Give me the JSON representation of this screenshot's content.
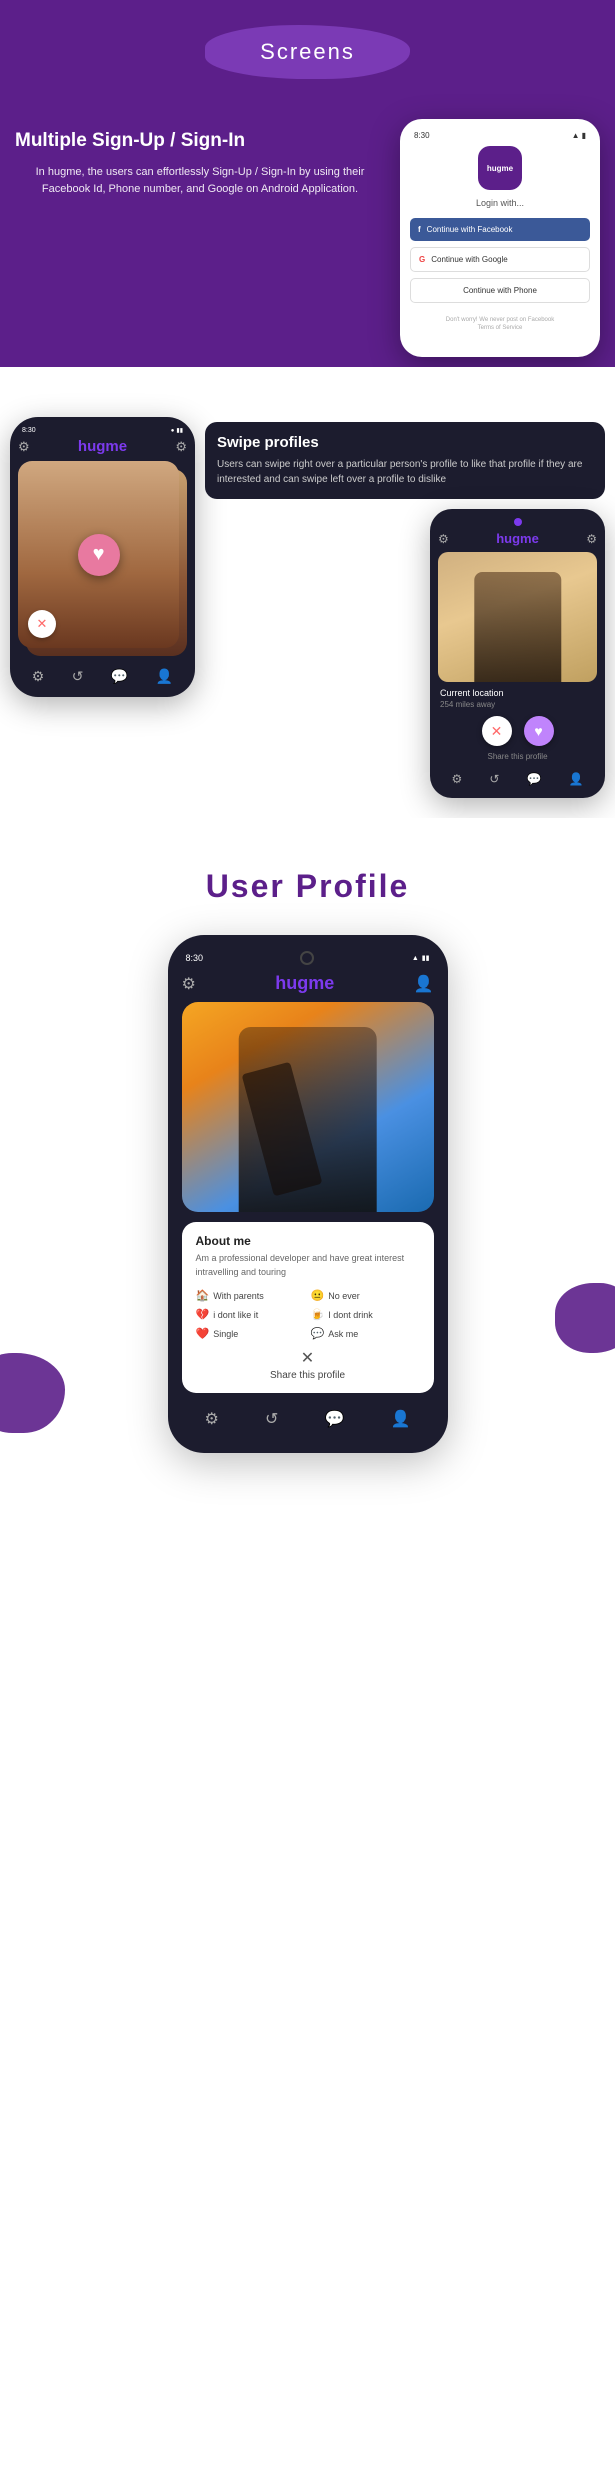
{
  "header": {
    "screens_label": "Screens"
  },
  "signup_section": {
    "title": "Multiple Sign-Up / Sign-In",
    "description": "In hugme, the users can effortlessly Sign-Up / Sign-In by using their Facebook Id, Phone number, and Google on Android Application.",
    "phone": {
      "status_time": "8:30",
      "app_logo": "hugme",
      "login_with": "Login with...",
      "facebook_btn": "Continue with Facebook",
      "google_btn": "Continue with Google",
      "phone_btn": "Continue with Phone",
      "footnote": "Don't worry! We never post on Facebook",
      "terms": "Terms of Service"
    }
  },
  "swipe_section": {
    "title": "Swipe profiles",
    "description": "Users can swipe right over a particular person's profile to like that profile if they are interested and can swipe left over a profile to dislike",
    "phone_left": {
      "status_time": "8:30",
      "logo": "hugme"
    },
    "phone_right": {
      "logo": "hugme",
      "location_label": "Current location",
      "distance": "254 miles away",
      "share_label": "Share this profile"
    }
  },
  "user_profile_section": {
    "title": "User Profile",
    "phone": {
      "status_time": "8:30",
      "logo": "hugme",
      "about_title": "About me",
      "about_text": "Am a professional developer and have great interest intravelling and touring",
      "tags": [
        {
          "icon": "🏠",
          "label": "With parents"
        },
        {
          "icon": "😐",
          "label": "No ever"
        },
        {
          "icon": "💔",
          "label": "i dont like it"
        },
        {
          "icon": "🍺",
          "label": "I dont drink"
        },
        {
          "icon": "❤️",
          "label": "Single"
        },
        {
          "icon": "💬",
          "label": "Ask me"
        }
      ],
      "share_label": "Share this profile"
    }
  },
  "nav_icons": {
    "settings": "⚙",
    "rewind": "↺",
    "chat": "💬",
    "profile": "👤",
    "heart": "♡",
    "x": "✕",
    "share": "✕"
  }
}
